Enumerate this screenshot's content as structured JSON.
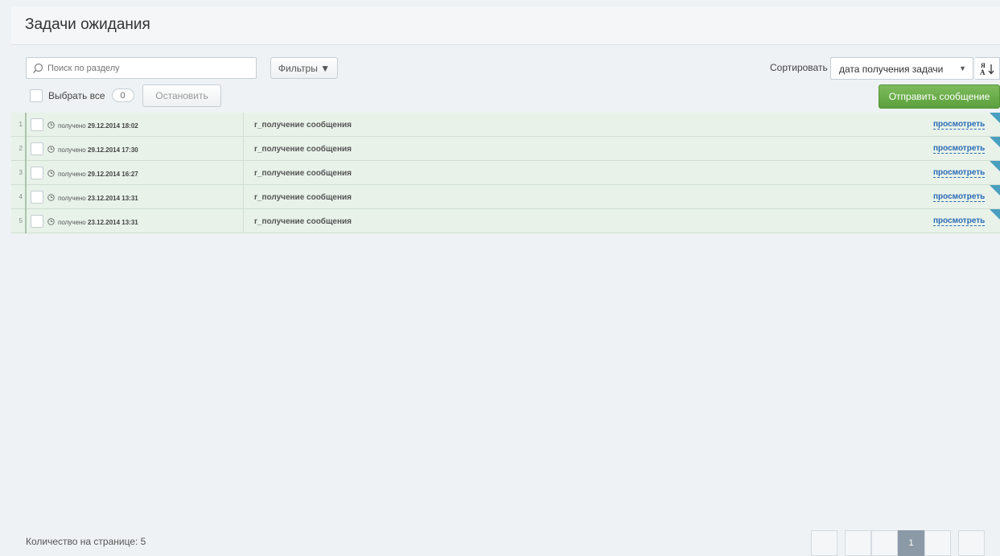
{
  "header": {
    "title": "Задачи ожидания"
  },
  "toolbar": {
    "search_placeholder": "Поиск по разделу",
    "filters_label": "Фильтры ▼",
    "sort_label": "Сортировать",
    "sort_value": "дата получения задачи",
    "sort_order_glyph": "Я A ↓",
    "select_all_label": "Выбрать все",
    "selected_count": "0",
    "stop_label": "Остановить",
    "send_message_label": "Отправить сообщение"
  },
  "rows": [
    {
      "num": "1",
      "received_prefix": "получено",
      "received_at": "29.12.2014 18:02",
      "task": "r_получение сообщения",
      "action": "просмотреть"
    },
    {
      "num": "2",
      "received_prefix": "получено",
      "received_at": "29.12.2014 17:30",
      "task": "r_получение сообщения",
      "action": "просмотреть"
    },
    {
      "num": "3",
      "received_prefix": "получено",
      "received_at": "29.12.2014 16:27",
      "task": "r_получение сообщения",
      "action": "просмотреть"
    },
    {
      "num": "4",
      "received_prefix": "получено",
      "received_at": "23.12.2014 13:31",
      "task": "r_получение сообщения",
      "action": "просмотреть"
    },
    {
      "num": "5",
      "received_prefix": "получено",
      "received_at": "23.12.2014 13:31",
      "task": "r_получение сообщения",
      "action": "просмотреть"
    }
  ],
  "footer": {
    "per_page_label": "Количество на странице: 5",
    "current_page": "1"
  },
  "colors": {
    "accent_green": "#5ca03c",
    "row_bg": "#e8f2e9",
    "link": "#2a6bb5",
    "flag": "#4a9fc0"
  }
}
